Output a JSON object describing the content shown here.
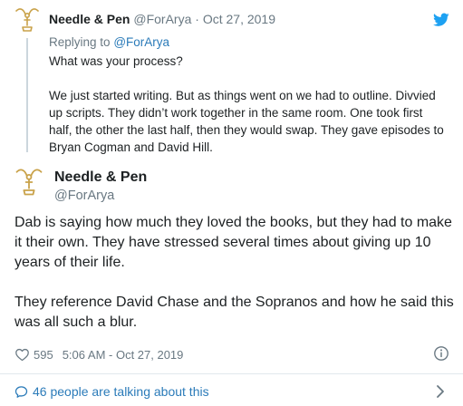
{
  "parent_tweet": {
    "display_name": "Needle & Pen",
    "handle": "@ForArya",
    "separator": "·",
    "date": "Oct 27, 2019",
    "reply_prefix": "Replying to",
    "reply_mention": "@ForArya",
    "paragraphs": [
      "What was your process?",
      "We just started writing. But as things went on we had to outline. Divvied up scripts. They didn’t work together in the same room. One took first half, the other the last half, then they would swap. They gave episodes to Bryan Cogman and David Hill."
    ]
  },
  "main_tweet": {
    "display_name": "Needle & Pen",
    "handle": "@ForArya",
    "paragraphs": [
      "Dab is saying how much they loved the books, but they had to make it their own. They have stressed several times about giving up 10 years of their life.",
      "They reference David Chase and the Sopranos and how he said this was all such a blur."
    ],
    "like_count": "595",
    "timestamp": "5:06 AM - Oct 27, 2019"
  },
  "footer": {
    "conversation_link": "46 people are talking about this"
  },
  "colors": {
    "link": "#2b7bb9",
    "muted": "#697882",
    "text": "#1c2022",
    "twitter_blue": "#1da1f2",
    "avatar_gold": "#c9a24a"
  },
  "icons": {
    "avatar": "emmy-statuette-icon",
    "brand": "twitter-bird-icon",
    "like": "heart-icon",
    "info": "info-icon",
    "conversation": "speech-bubble-icon",
    "more": "chevron-right-icon"
  }
}
